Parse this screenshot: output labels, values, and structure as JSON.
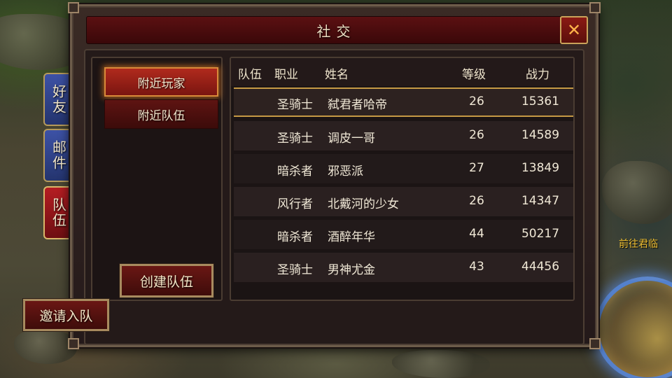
{
  "window": {
    "title": "社交",
    "close_label": "✕"
  },
  "side_tabs": [
    {
      "label": "好友",
      "active": false
    },
    {
      "label": "邮件",
      "active": false
    },
    {
      "label": "队伍",
      "active": true
    }
  ],
  "categories": [
    {
      "label": "附近玩家",
      "active": true
    },
    {
      "label": "附近队伍",
      "active": false
    }
  ],
  "buttons": {
    "create_team": "创建队伍",
    "invite": "邀请入队"
  },
  "table": {
    "headers": {
      "team": "队伍",
      "job": "职业",
      "name": "姓名",
      "level": "等级",
      "power": "战力"
    },
    "rows": [
      {
        "team": "",
        "job": "圣骑士",
        "name": "弑君者哈帝",
        "level": "26",
        "power": "15361"
      },
      {
        "team": "",
        "job": "圣骑士",
        "name": "调皮一哥",
        "level": "26",
        "power": "14589"
      },
      {
        "team": "",
        "job": "暗杀者",
        "name": "邪恶派",
        "level": "27",
        "power": "13849"
      },
      {
        "team": "",
        "job": "风行者",
        "name": "北戴河的少女",
        "level": "26",
        "power": "14347"
      },
      {
        "team": "",
        "job": "暗杀者",
        "name": "酒醉年华",
        "level": "44",
        "power": "50217"
      },
      {
        "team": "",
        "job": "圣骑士",
        "name": "男神尤金",
        "level": "43",
        "power": "44456"
      }
    ]
  },
  "world": {
    "npc_label": "前往君临"
  },
  "colors": {
    "accent_gold": "#c69a45",
    "tab_blue": "#3d52a6",
    "tab_red": "#b51d22",
    "npc_label": "#f0c033"
  }
}
